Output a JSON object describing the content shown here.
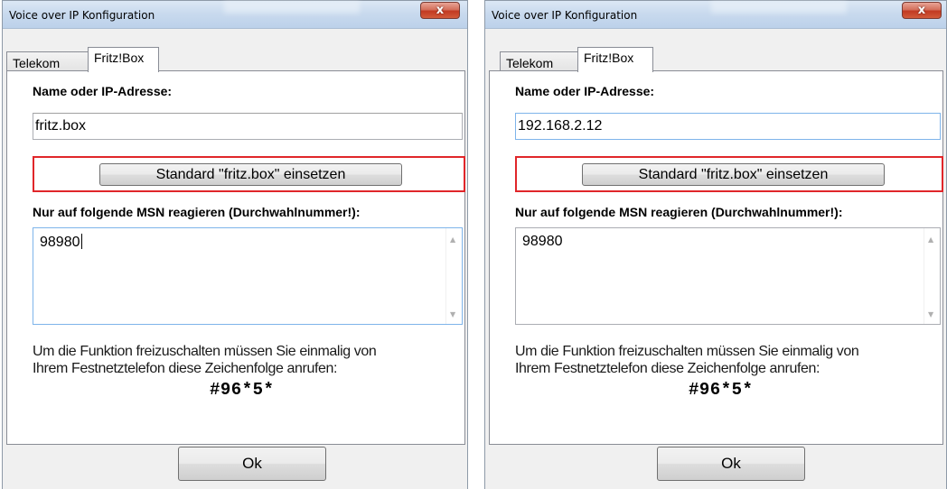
{
  "dialogs": [
    {
      "window_title": "Voice over IP Konfiguration",
      "close_glyph": "x",
      "tabs": [
        "Telekom",
        "Fritz!Box"
      ],
      "active_tab": "Fritz!Box",
      "name_label": "Name oder IP-Adresse:",
      "name_value": "fritz.box",
      "standard_button": "Standard  \"fritz.box\" einsetzen",
      "msn_label": "Nur auf folgende MSN reagieren (Durchwahlnummer!):",
      "msn_value": "98980",
      "info_line1": "Um die Funktion freizuschalten müssen Sie einmalig von",
      "info_line2": "Ihrem Festnetztelefon diese Zeichenfolge anrufen:",
      "code": "#96*5*",
      "ok_button": "Ok"
    },
    {
      "window_title": "Voice over IP Konfiguration",
      "close_glyph": "x",
      "tabs": [
        "Telekom",
        "Fritz!Box"
      ],
      "active_tab": "Fritz!Box",
      "name_label": "Name oder IP-Adresse:",
      "name_value": "192.168.2.12",
      "standard_button": "Standard  \"fritz.box\" einsetzen",
      "msn_label": "Nur auf folgende MSN reagieren (Durchwahlnummer!):",
      "msn_value": "98980",
      "info_line1": "Um die Funktion freizuschalten müssen Sie einmalig von",
      "info_line2": "Ihrem Festnetztelefon diese Zeichenfolge anrufen:",
      "code": "#96*5*",
      "ok_button": "Ok"
    }
  ],
  "icons": {
    "scroll_up": "▲",
    "scroll_down": "▼"
  },
  "colors": {
    "highlight": "#e0262a",
    "close_button": "#c23a22",
    "focus_border": "#7eb4ea"
  }
}
